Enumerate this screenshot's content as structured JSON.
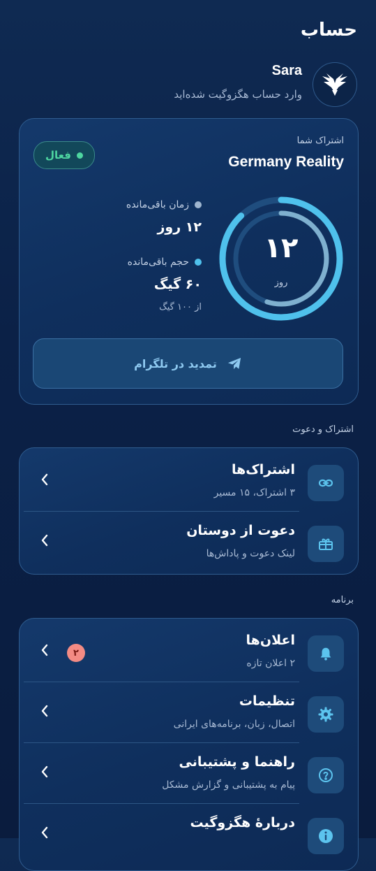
{
  "page": {
    "title": "حساب"
  },
  "user": {
    "name": "Sara",
    "subtitle": "وارد حساب هگزوگیت شده‌اید"
  },
  "subscription": {
    "label": "اشتراک شما",
    "plan": "Germany Reality",
    "status": "فعال",
    "ring": {
      "value": "۱۲",
      "unit": "روز",
      "outer_fraction": 0.88,
      "inner_fraction": 0.55
    },
    "time_left": {
      "label": "زمان باقی‌مانده",
      "value": "۱۲ روز"
    },
    "volume_left": {
      "label": "حجم باقی‌مانده",
      "value": "۶۰ گیگ",
      "total": "از ۱۰۰ گیگ"
    },
    "renew_label": "تمدید در تلگرام"
  },
  "sections": [
    {
      "label": "اشتراک و دعوت",
      "items": [
        {
          "title": "اشتراک‌ها",
          "subtitle": "۳ اشتراک، ۱۵ مسیر",
          "icon": "link-icon"
        },
        {
          "title": "دعوت از دوستان",
          "subtitle": "لینک دعوت و پاداش‌ها",
          "icon": "gift-icon"
        }
      ]
    },
    {
      "label": "برنامه",
      "items": [
        {
          "title": "اعلان‌ها",
          "subtitle": "۲ اعلان تازه",
          "icon": "bell-icon",
          "badge": "۲"
        },
        {
          "title": "تنظیمات",
          "subtitle": "اتصال، زبان، برنامه‌های ایرانی",
          "icon": "gear-icon"
        },
        {
          "title": "راهنما و پشتیبانی",
          "subtitle": "پیام به پشتیبانی و گزارش مشکل",
          "icon": "help-icon"
        },
        {
          "title": "دربارهٔ هگزوگیت",
          "subtitle": "",
          "icon": "info-icon"
        }
      ]
    }
  ],
  "colors": {
    "accent": "#4fb8e8",
    "status_green": "#4ed6a0",
    "badge_red": "#f38b84"
  }
}
